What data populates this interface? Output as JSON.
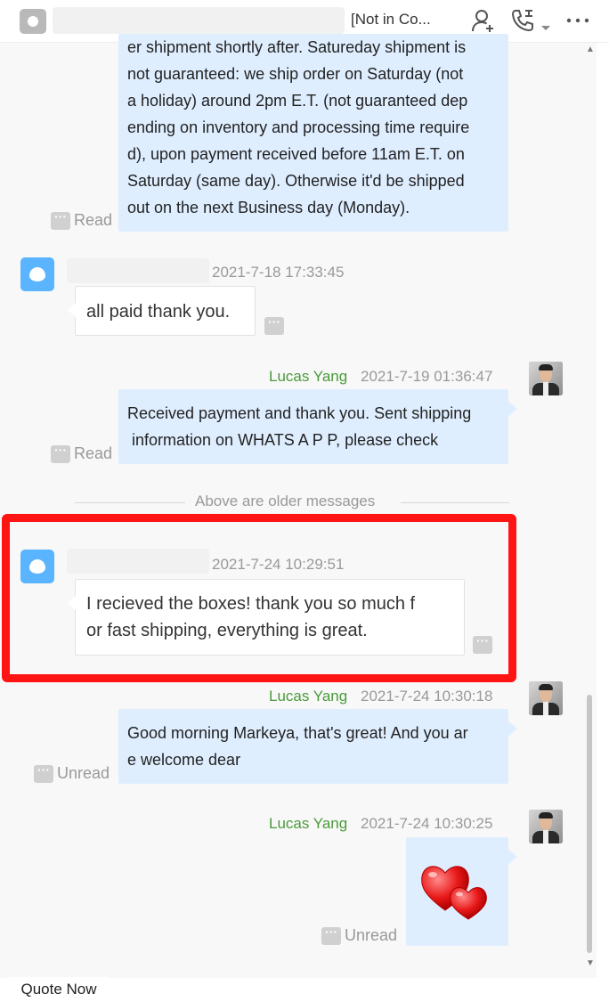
{
  "header": {
    "status": "[Not in Co...",
    "icons": [
      "add-contact-icon",
      "phone-icon",
      "more-icon"
    ]
  },
  "messages": [
    {
      "direction": "out",
      "lines": [
        "er shipment shortly after. Satureday shipment is",
        "not guaranteed: we ship order on Saturday (not",
        "a holiday) around 2pm E.T. (not guaranteed dep",
        "ending on inventory and processing time require",
        "d), upon payment received before 11am E.T. on",
        "Saturday (same day). Otherwise it'd be shipped",
        "out on the next Business day (Monday)."
      ],
      "status": "Read"
    },
    {
      "direction": "in",
      "timestamp": "2021-7-18 17:33:45",
      "text": "all paid thank you."
    },
    {
      "direction": "out",
      "sender": "Lucas Yang",
      "timestamp": "2021-7-19 01:36:47",
      "lines": [
        "Received payment and thank you. Sent shipping",
        " information on WHATS A P P, please check"
      ],
      "status": "Read"
    },
    {
      "direction": "in",
      "timestamp": "2021-7-24 10:29:51",
      "lines": [
        "I recieved the boxes! thank you so much f",
        "or fast shipping, everything is great."
      ]
    },
    {
      "direction": "out",
      "sender": "Lucas Yang",
      "timestamp": "2021-7-24 10:30:18",
      "lines": [
        "Good morning Markeya, that's great! And you ar",
        "e welcome dear"
      ],
      "status": "Unread"
    },
    {
      "direction": "out",
      "sender": "Lucas Yang",
      "timestamp": "2021-7-24 10:30:25",
      "sticker": "hearts-sticker",
      "status": "Unread"
    }
  ],
  "divider": "Above are older messages",
  "quote_button": "Quote Now",
  "colors": {
    "highlight": "#ff1414",
    "outgoing_bubble": "#dfeeff",
    "sender_name": "#4a9a3a"
  }
}
